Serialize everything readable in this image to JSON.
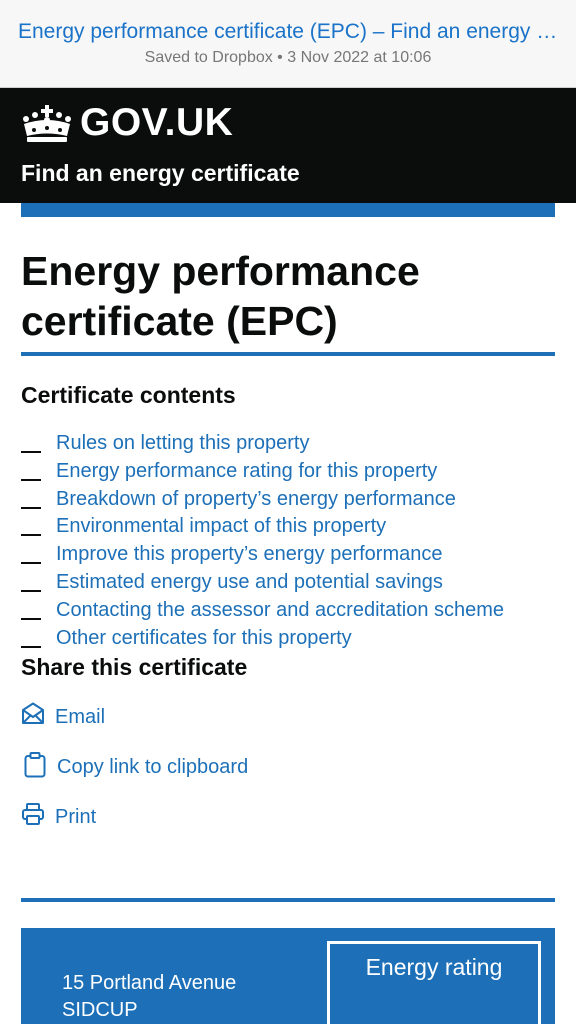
{
  "browser": {
    "title": "Energy performance certificate (EPC) – Find an energy certificate",
    "subtitle": "Saved to Dropbox • 3 Nov 2022 at 10:06"
  },
  "header": {
    "logo_icon": "crown-icon",
    "logo_text": "GOV.UK",
    "service_name": "Find an energy certificate"
  },
  "main": {
    "title": "Energy performance certificate (EPC)",
    "contents_heading": "Certificate contents",
    "contents": [
      "Rules on letting this property",
      "Energy performance rating for this property",
      "Breakdown of property’s energy performance",
      "Environmental impact of this property",
      "Improve this property’s energy performance",
      "Estimated energy use and potential savings",
      "Contacting the assessor and accreditation scheme",
      "Other certificates for this property"
    ],
    "share_heading": "Share this certificate",
    "share": {
      "email": {
        "label": "Email",
        "icon": "envelope-icon"
      },
      "copy": {
        "label": "Copy link to clipboard",
        "icon": "clipboard-icon"
      },
      "print": {
        "label": "Print",
        "icon": "printer-icon"
      }
    }
  },
  "summary": {
    "address_line1": "15 Portland Avenue",
    "address_line2": "SIDCUP",
    "rating_label": "Energy rating"
  },
  "colors": {
    "link": "#1d70b8",
    "header_bg": "#0b0c0c",
    "accent": "#1d70b8"
  }
}
